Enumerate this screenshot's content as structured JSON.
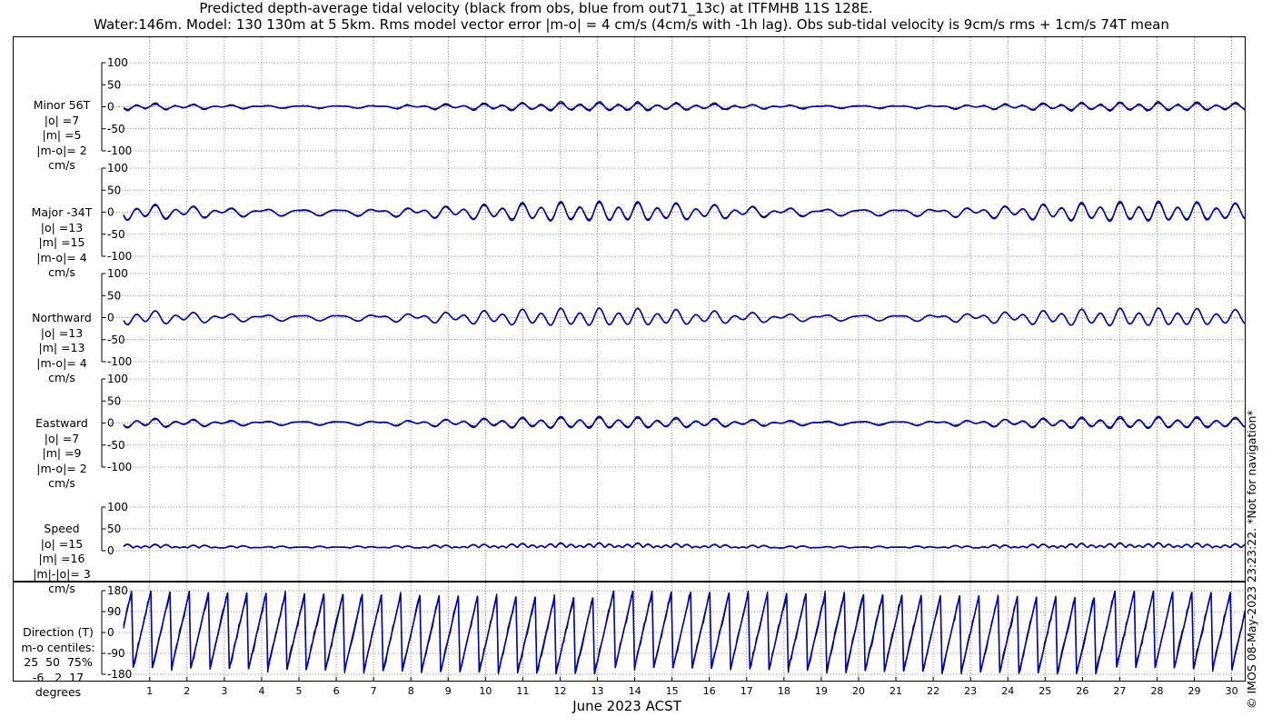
{
  "title_line1": "Predicted depth-average tidal velocity (black from obs, blue from out71_13c) at ITFMHB 11S 128E.",
  "title_line2": "Water:146m. Model: 130 130m at 5 5km. Rms model vector error |m-o| = 4 cm/s (4cm/s with -1h lag). Obs sub-tidal velocity is 9cm/s rms + 1cm/s 74T mean",
  "x_axis_title": "June 2023 ACST",
  "copyright": "© IMOS 08-May-2023 23:23:22. *Not for navigation*",
  "colors": {
    "obs": "#000000",
    "model": "#0000cc",
    "grid": "#777777"
  },
  "chart_data": {
    "type": "line",
    "x_ticks": [
      "1",
      "2",
      "3",
      "4",
      "5",
      "6",
      "7",
      "8",
      "9",
      "10",
      "11",
      "12",
      "13",
      "14",
      "15",
      "16",
      "17",
      "18",
      "19",
      "20",
      "21",
      "22",
      "23",
      "24",
      "25",
      "26",
      "27",
      "28",
      "29",
      "30"
    ],
    "x_range_days": [
      0.3,
      30.35
    ],
    "series_names": [
      "obs (black)",
      "model (blue)"
    ],
    "panels": [
      {
        "id": "minor",
        "label": [
          "Minor 56T",
          "|o| =7",
          "|m| =5",
          "|m-o|= 2",
          "cm/s"
        ],
        "ylim": [
          -100,
          100
        ],
        "yticks": [
          "100",
          "50",
          "0",
          "-50",
          "-100"
        ],
        "amplitude_obs": 7,
        "amplitude_model": 5
      },
      {
        "id": "major",
        "label": [
          "Major -34T",
          "|o| =13",
          "|m| =15",
          "|m-o|= 4",
          "cm/s"
        ],
        "ylim": [
          -100,
          100
        ],
        "yticks": [
          "100",
          "50",
          "0",
          "-50",
          "-100"
        ],
        "amplitude_obs": 13,
        "amplitude_model": 15
      },
      {
        "id": "north",
        "label": [
          "Northward",
          "|o| =13",
          "|m| =13",
          "|m-o|= 4",
          "cm/s"
        ],
        "ylim": [
          -100,
          100
        ],
        "yticks": [
          "100",
          "50",
          "0",
          "-50",
          "-100"
        ],
        "amplitude_obs": 13,
        "amplitude_model": 13
      },
      {
        "id": "east",
        "label": [
          "Eastward",
          "|o| =7",
          "|m| =9",
          "|m-o|= 2",
          "cm/s"
        ],
        "ylim": [
          -100,
          100
        ],
        "yticks": [
          "100",
          "50",
          "0",
          "-50",
          "-100"
        ],
        "amplitude_obs": 7,
        "amplitude_model": 9
      },
      {
        "id": "speed",
        "label": [
          "Speed",
          "|o| =15",
          "|m| =16",
          "|m|-|o|= 3",
          "cm/s"
        ],
        "ylim": [
          0,
          100
        ],
        "yticks": [
          "100",
          "50",
          "0"
        ],
        "amplitude_obs": 15,
        "amplitude_model": 16
      },
      {
        "id": "direction",
        "label": [
          "Direction (T)",
          "m-o centiles:",
          "25  50  75%",
          "-6   2  17",
          "degrees"
        ],
        "ylim": [
          -180,
          180
        ],
        "yticks": [
          "180",
          "90",
          "0",
          "-90",
          "-180"
        ]
      }
    ]
  }
}
